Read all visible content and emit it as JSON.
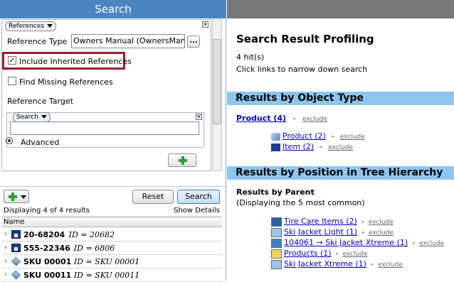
{
  "search_panel": {
    "title": "Search",
    "references_dropdown": "References",
    "reference_type_label": "Reference Type",
    "reference_type_value": "Owners Manual (OwnersManual)",
    "browse_label": "...",
    "include_inherited_label": "Include Inherited References",
    "include_inherited_checked": "✓",
    "find_missing_label": "Find Missing References",
    "reference_target_label": "Reference Target",
    "search_dropdown": "Search",
    "advanced_label": "Advanced",
    "close_glyph": "✕",
    "reset_label": "Reset",
    "search_label": "Search",
    "displaying_text": "Displaying 4 of 4 results",
    "show_details_label": "Show Details",
    "name_column_header": "Name"
  },
  "results": [
    {
      "code": "20-68204",
      "detail": "ID = 20682",
      "icon": "item-icon"
    },
    {
      "code": "555-22346",
      "detail": "ID = 6806",
      "icon": "item-icon"
    },
    {
      "code": "SKU 00001",
      "detail": "ID = SKU 00001",
      "icon": "product-icon"
    },
    {
      "code": "SKU 00011",
      "detail": "ID = SKU 00011",
      "icon": "product-icon"
    }
  ],
  "profiling": {
    "title": "Search Result Profiling",
    "hits": "4 hit(s)",
    "hint": "Click links to narrow down search",
    "by_type_title": "Results by Object Type",
    "product_top_link": "Product (4)",
    "exclude_label": "exclude",
    "dash": "-",
    "type_rows": [
      {
        "label": "Product (2)",
        "icon": "product-icon"
      },
      {
        "label": "Item (2)",
        "icon": "item-icon"
      }
    ],
    "by_position_title": "Results by Position in Tree Hierarchy",
    "by_parent_label": "Results by Parent",
    "by_parent_note": "(Displaying the 5 most common)",
    "parent_rows": [
      {
        "label": "Tire Care Items (2)",
        "icon": "folder-blue-icon"
      },
      {
        "label": "Ski Jacket Light (1)",
        "icon": "folder-light-icon"
      },
      {
        "label": "104061 → Ski Jacket Xtreme (1)",
        "icon": "folder-teal-icon"
      },
      {
        "label": "Products (1)",
        "icon": "folder-yellow-icon"
      },
      {
        "label": "Ski Jacket Xtreme (1)",
        "icon": "folder-light-icon"
      }
    ]
  },
  "colors": {
    "search_header": "#4a86c2",
    "highlight_border": "#9e1f2b",
    "section_bar": "#8cc6ef",
    "link": "#0000cc"
  }
}
